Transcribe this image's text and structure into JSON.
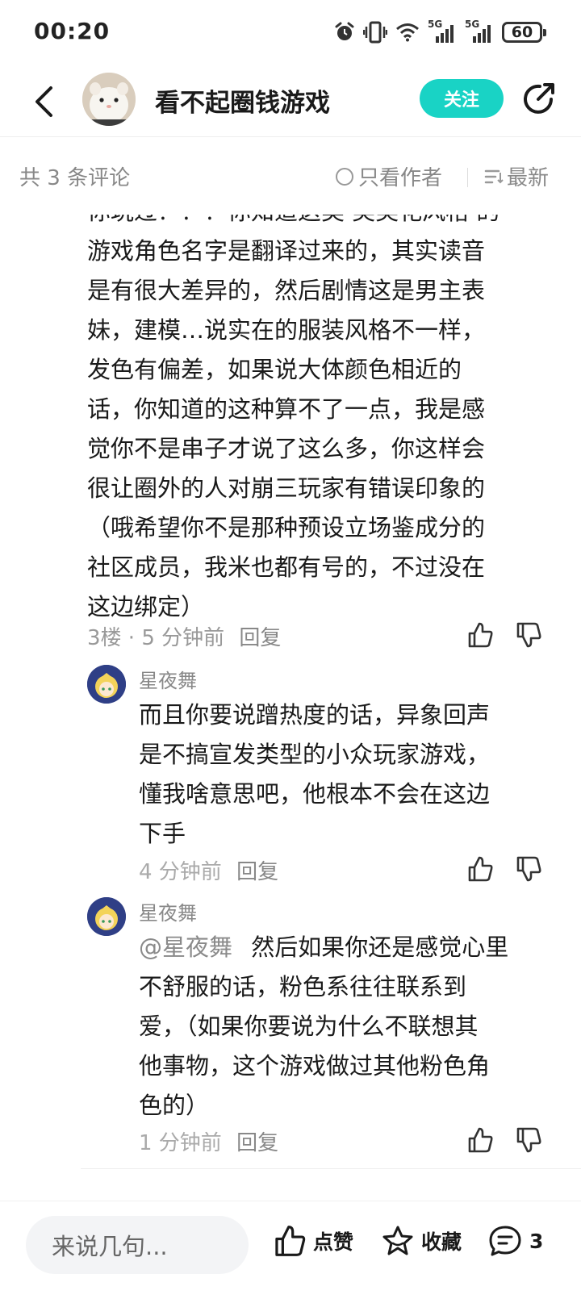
{
  "status_bar": {
    "time": "00:20",
    "signal_1_label": "5G",
    "signal_2_label": "5G",
    "battery": "60"
  },
  "header": {
    "title": "看不起圈钱游戏",
    "follow_label": "关注"
  },
  "filter": {
    "count_text": "共 3 条评论",
    "author_only": "只看作者",
    "sort": "最新"
  },
  "floor": {
    "lines": [
      "你玩过？？？你知道这类‘美美花风格’的",
      "游戏角色名字是翻译过来的，其实读音",
      "是有很大差异的，然后剧情这是男主表",
      "妹，建模…说实在的服装风格不一样，",
      "发色有偏差，如果说大体颜色相近的",
      "话，你知道的这种算不了一点，我是感",
      "觉你不是串子才说了这么多，你这样会",
      "很让圈外的人对崩三玩家有错误印象的",
      "（哦希望你不是那种预设立场鉴成分的",
      "社区成员，我米也都有号的，不过没在",
      "这边绑定）"
    ],
    "meta": "3楼 · 5 分钟前",
    "reply_label": "回复"
  },
  "replies": [
    {
      "name": "星夜舞",
      "mention": "",
      "lines": [
        "而且你要说蹭热度的话，异象回声",
        "是不搞宣发类型的小众玩家游戏，",
        "懂我啥意思吧，他根本不会在这边",
        "下手"
      ],
      "meta": "4 分钟前",
      "reply_label": "回复"
    },
    {
      "name": "星夜舞",
      "mention": "@星夜舞",
      "first_line_rest": "然后如果你还是感觉心里",
      "lines": [
        "不舒服的话，粉色系往往联系到",
        "爱，（如果你要说为什么不联想其",
        "他事物，这个游戏做过其他粉色角",
        "色的）"
      ],
      "meta": "1 分钟前",
      "reply_label": "回复"
    }
  ],
  "bottom_bar": {
    "input_placeholder": "来说几句...",
    "like_label": "点赞",
    "fav_label": "收藏",
    "comment_count": "3"
  },
  "colors": {
    "accent": "#19d3c5",
    "muted_text": "#888888",
    "body_text": "#1a1a1a"
  }
}
